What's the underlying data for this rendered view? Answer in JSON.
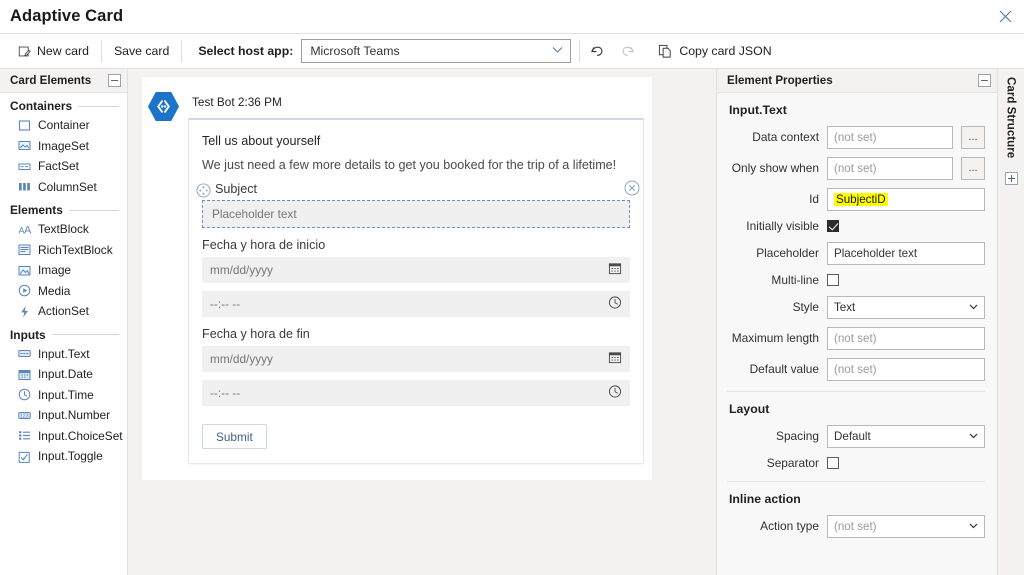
{
  "window": {
    "title": "Adaptive Card",
    "close_label": "✕"
  },
  "toolbar": {
    "new_card": "New card",
    "save_card": "Save card",
    "host_app_label": "Select host app:",
    "host_app_value": "Microsoft Teams",
    "undo_icon": "undo-icon",
    "redo_icon": "redo-icon",
    "copy_json": "Copy card JSON"
  },
  "left_panel": {
    "header": "Card Elements",
    "groups": [
      {
        "name": "Containers",
        "items": [
          {
            "label": "Container",
            "icon": "container-icon"
          },
          {
            "label": "ImageSet",
            "icon": "imageset-icon"
          },
          {
            "label": "FactSet",
            "icon": "factset-icon"
          },
          {
            "label": "ColumnSet",
            "icon": "columnset-icon"
          }
        ]
      },
      {
        "name": "Elements",
        "items": [
          {
            "label": "TextBlock",
            "icon": "textblock-icon"
          },
          {
            "label": "RichTextBlock",
            "icon": "richtextblock-icon"
          },
          {
            "label": "Image",
            "icon": "image-icon"
          },
          {
            "label": "Media",
            "icon": "media-icon"
          },
          {
            "label": "ActionSet",
            "icon": "actionset-icon"
          }
        ]
      },
      {
        "name": "Inputs",
        "items": [
          {
            "label": "Input.Text",
            "icon": "input-text-icon"
          },
          {
            "label": "Input.Date",
            "icon": "input-date-icon"
          },
          {
            "label": "Input.Time",
            "icon": "input-time-icon"
          },
          {
            "label": "Input.Number",
            "icon": "input-number-icon"
          },
          {
            "label": "Input.ChoiceSet",
            "icon": "input-choiceset-icon"
          },
          {
            "label": "Input.Toggle",
            "icon": "input-toggle-icon"
          }
        ]
      }
    ]
  },
  "card_preview": {
    "bot_meta": "Test Bot 2:36 PM",
    "avatar_icon": "bot-avatar-icon",
    "title": "Tell us about yourself",
    "description": "We just need a few more details to get you booked for the trip of a lifetime!",
    "selected": {
      "label": "Subject",
      "placeholder": "Placeholder text",
      "drag_icon": "drag-handle-icon",
      "remove_icon": "remove-circle-icon"
    },
    "fields": [
      {
        "label": "Fecha y hora de inicio",
        "inputs": [
          {
            "value": "mm/dd/yyyy",
            "icon": "calendar-icon"
          },
          {
            "value": "--:-- --",
            "icon": "clock-icon"
          }
        ]
      },
      {
        "label": "Fecha y hora de fin",
        "inputs": [
          {
            "value": "mm/dd/yyyy",
            "icon": "calendar-icon"
          },
          {
            "value": "--:-- --",
            "icon": "clock-icon"
          }
        ]
      }
    ],
    "submit_label": "Submit"
  },
  "properties": {
    "header": "Element Properties",
    "element_type": "Input.Text",
    "rows": [
      {
        "label": "Data context",
        "value": "(not set)",
        "type": "text-browse",
        "placeholder": true
      },
      {
        "label": "Only show when",
        "value": "(not set)",
        "type": "text-browse",
        "placeholder": true
      },
      {
        "label": "Id",
        "value": "SubjectiD",
        "type": "text-highlight",
        "placeholder": false
      },
      {
        "label": "Initially visible",
        "value": "",
        "type": "checkbox",
        "checked": true
      },
      {
        "label": "Placeholder",
        "value": "Placeholder text",
        "type": "text",
        "placeholder": false
      },
      {
        "label": "Multi-line",
        "value": "",
        "type": "checkbox",
        "checked": false
      },
      {
        "label": "Style",
        "value": "Text",
        "type": "select",
        "placeholder": false
      },
      {
        "label": "Maximum length",
        "value": "(not set)",
        "type": "text",
        "placeholder": true
      },
      {
        "label": "Default value",
        "value": "(not set)",
        "type": "text",
        "placeholder": true
      }
    ],
    "layout_section": {
      "title": "Layout",
      "rows": [
        {
          "label": "Spacing",
          "value": "Default",
          "type": "select",
          "placeholder": false
        },
        {
          "label": "Separator",
          "value": "",
          "type": "checkbox",
          "checked": false
        }
      ]
    },
    "inline_action_section": {
      "title": "Inline action",
      "rows": [
        {
          "label": "Action type",
          "value": "(not set)",
          "type": "select",
          "placeholder": true
        }
      ]
    },
    "browse_label": "..."
  },
  "card_structure": {
    "label": "Card Structure",
    "expand_icon": "expand-icon"
  },
  "colors": {
    "accent": "#2b7cd3",
    "highlight": "#ffff00",
    "panel_bg": "#f3f2f1",
    "canvas_bg": "#f3f2f1"
  }
}
